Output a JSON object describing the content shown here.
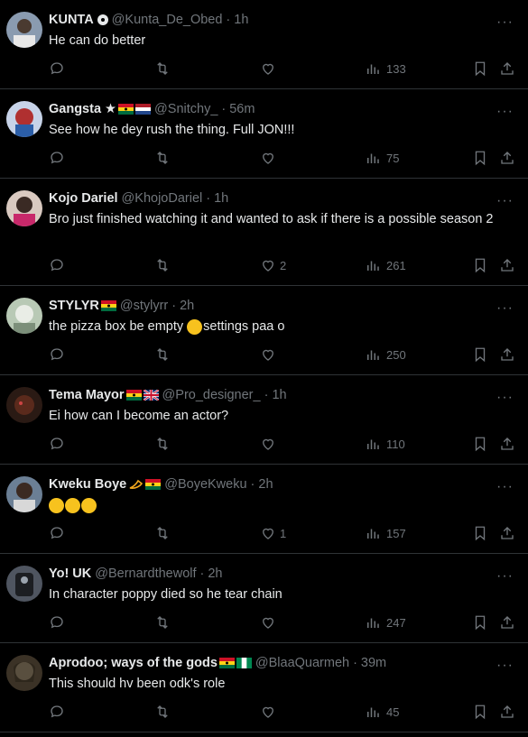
{
  "tweets": [
    {
      "name": "KUNTA",
      "handle": "@Kunta_De_Obed",
      "time": "1h",
      "text": "He can do better",
      "likes": "",
      "views": "133"
    },
    {
      "name": "Gangsta ★",
      "handle": "@Snitchy_",
      "time": "56m",
      "text": "See how he dey rush the thing. Full JON!!!",
      "likes": "",
      "views": "75"
    },
    {
      "name": "Kojo Dariel",
      "handle": "@KhojoDariel",
      "time": "1h",
      "text": "Bro just finished watching it and wanted to ask if there is a possible season 2",
      "likes": "2",
      "views": "261"
    },
    {
      "name": "STYLYR",
      "handle": "@stylyrr",
      "time": "2h",
      "text_before": "the pizza box be empty ",
      "text_after": "settings paa o",
      "likes": "",
      "views": "250"
    },
    {
      "name": "Tema Mayor",
      "handle": "@Pro_designer_",
      "time": "1h",
      "text": "Ei how can I become an actor?",
      "likes": "",
      "views": "110"
    },
    {
      "name": "Kweku Boye",
      "handle": "@BoyeKweku",
      "time": "2h",
      "text": "",
      "likes": "1",
      "views": "157"
    },
    {
      "name": "Yo! UK",
      "handle": "@Bernardthewolf",
      "time": "2h",
      "text": "In character poppy died so he tear chain",
      "likes": "",
      "views": "247"
    },
    {
      "name": "Aprodoo; ways of the gods",
      "handle": "@BlaaQuarmeh",
      "time": "39m",
      "text": "This should hv been odk's role",
      "likes": "",
      "views": "45"
    }
  ],
  "separator": "·",
  "more_label": "···",
  "colors": {
    "background": "#000000",
    "text": "#e7e9ea",
    "muted": "#71767b",
    "border": "#2f3336"
  }
}
